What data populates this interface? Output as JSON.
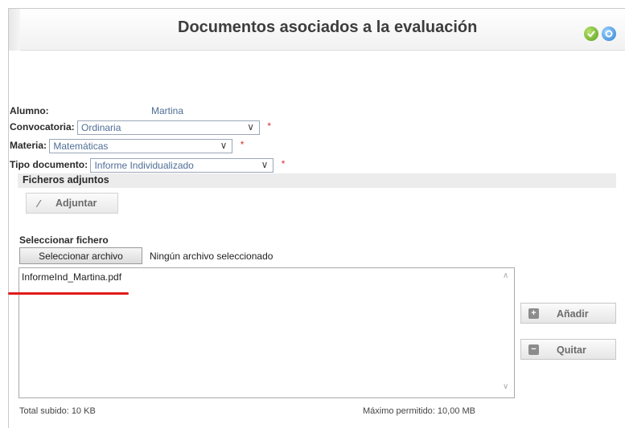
{
  "header": {
    "title": "Documentos asociados a la evaluación",
    "ok_icon": "check-circle-icon",
    "info_icon": "info-circle-icon",
    "ok_color": "#5a9e1a",
    "info_color": "#2b7fd1"
  },
  "form": {
    "alumno_label": "Alumno:",
    "alumno_value": "Martina",
    "convocatoria_label": "Convocatoria:",
    "convocatoria_value": "Ordinaria",
    "materia_label": "Materia:",
    "materia_value": "Matemáticas",
    "tipo_label": "Tipo documento:",
    "tipo_value": "Informe Individualizado",
    "required_mark": "*"
  },
  "attachments": {
    "section_title": "Ficheros adjuntos",
    "attach_button": "Adjuntar",
    "attach_icon": "paperclip-icon",
    "select_title": "Seleccionar fichero",
    "file_button": "Seleccionar archivo",
    "file_status": "Ningún archivo seleccionado",
    "files": [
      "InformeInd_Martina.pdf"
    ],
    "add_button": "Añadir",
    "remove_button": "Quitar",
    "add_icon": "plus-square-icon",
    "remove_icon": "minus-square-icon",
    "total_uploaded": "Total subido: 10 KB",
    "max_allowed": "Máximo permitido: 10,00 MB",
    "highlight_color": "#e01b1b"
  }
}
